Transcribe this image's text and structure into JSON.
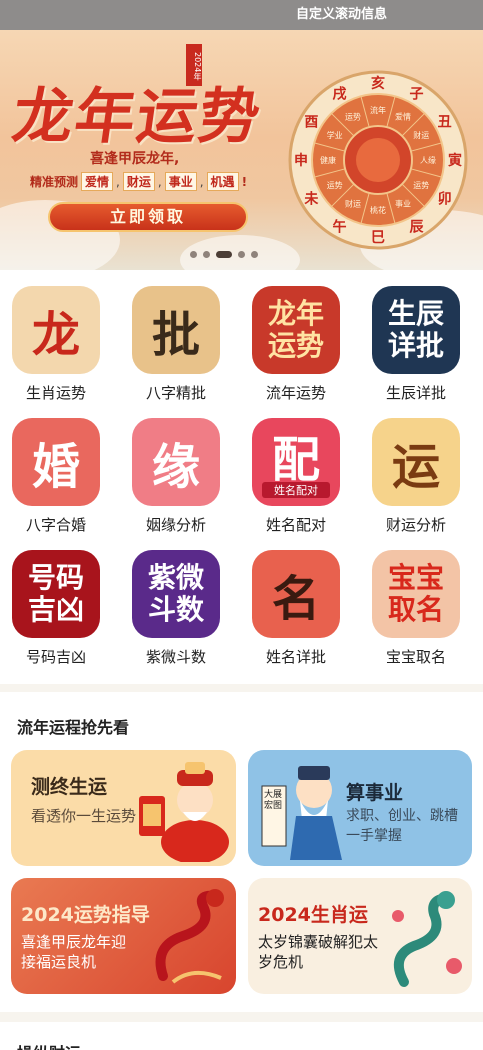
{
  "marquee": {
    "text": "自定义滚动信息"
  },
  "banner": {
    "title": "龙年运势",
    "stamp": "2024年",
    "subtitle": "喜逢甲辰龙年,",
    "tagline_lead": "精准预测",
    "tags": [
      "爱情",
      "财运",
      "事业",
      "机遇"
    ],
    "tagline_tail": "!",
    "cta": "立即领取",
    "wheel_outer": [
      "子",
      "丑",
      "寅",
      "卯",
      "辰",
      "巳",
      "午",
      "未",
      "申",
      "酉",
      "戌",
      "亥"
    ],
    "wheel_inner": [
      "爱情",
      "财运",
      "人缘",
      "运势",
      "事业",
      "桃花",
      "财运",
      "运势",
      "健康",
      "学业",
      "运势",
      "流年"
    ],
    "active_slide": 2,
    "slide_count": 5
  },
  "services": [
    {
      "label": "生肖运势",
      "icon": "dragon-zodiac-icon",
      "glyph": "龙",
      "bg": "#f3d7ad",
      "fg": "#c8281c"
    },
    {
      "label": "八字精批",
      "icon": "bazi-scroll-icon",
      "glyph": "批",
      "bg": "#e8c28a",
      "fg": "#3a2a1a"
    },
    {
      "label": "流年运势",
      "icon": "yearly-fortune-icon",
      "glyph": "龙年运势",
      "bg": "#c8392a",
      "fg": "#ffe3a3"
    },
    {
      "label": "生辰详批",
      "icon": "birth-yinyang-icon",
      "glyph": "生辰详批",
      "bg": "#1f3653",
      "fg": "#ffffff"
    },
    {
      "label": "八字合婚",
      "icon": "wedding-dress-icon",
      "glyph": "婚",
      "bg": "#e9685e",
      "fg": "#ffffff"
    },
    {
      "label": "姻缘分析",
      "icon": "fate-blossom-icon",
      "glyph": "缘",
      "bg": "#f07d86",
      "fg": "#ffffff"
    },
    {
      "label": "姓名配对",
      "icon": "name-pair-icon",
      "glyph": "配",
      "bg": "#e8475d",
      "fg": "#ffffff",
      "caption": "姓名配对"
    },
    {
      "label": "财运分析",
      "icon": "coin-fortune-icon",
      "glyph": "运",
      "bg": "#f6d38b",
      "fg": "#7a3b12"
    },
    {
      "label": "号码吉凶",
      "icon": "number-luck-icon",
      "glyph": "号码吉凶",
      "bg": "#a8141c",
      "fg": "#ffffff"
    },
    {
      "label": "紫微斗数",
      "icon": "ziwei-stars-icon",
      "glyph": "紫微斗数",
      "bg": "#5a2a8a",
      "fg": "#ffffff"
    },
    {
      "label": "姓名详批",
      "icon": "name-brush-icon",
      "glyph": "名",
      "bg": "#e8614e",
      "fg": "#3a1a10"
    },
    {
      "label": "宝宝取名",
      "icon": "baby-tiger-icon",
      "glyph": "宝宝取名",
      "bg": "#f3c4a6",
      "fg": "#d8281c"
    }
  ],
  "section": {
    "title": "流年运程抢先看",
    "cards": [
      {
        "title": "测终生运",
        "desc": "看透你一生运势",
        "bg": "#fbdca8",
        "tc": "#3a2a1a",
        "dc": "#5a4a3a"
      },
      {
        "title": "算事业",
        "desc": "求职、创业、跳槽一手掌握",
        "bg": "#8fc2e6",
        "tc": "#1c2a3a",
        "dc": "#3a4a5a",
        "scroll": "大展宏图"
      },
      {
        "title": "2024运势指导",
        "desc": "喜逢甲辰龙年迎接福运良机",
        "bg": "#e8634a",
        "tc": "#fde8c8",
        "dc": "#ffffff"
      },
      {
        "title": "2024生肖运",
        "desc": "太岁锦囊破解犯太岁危机",
        "bg": "#f9efe0",
        "tc": "#c8281c",
        "dc": "#222222"
      }
    ]
  },
  "next_section": {
    "title": "操纵财运"
  }
}
